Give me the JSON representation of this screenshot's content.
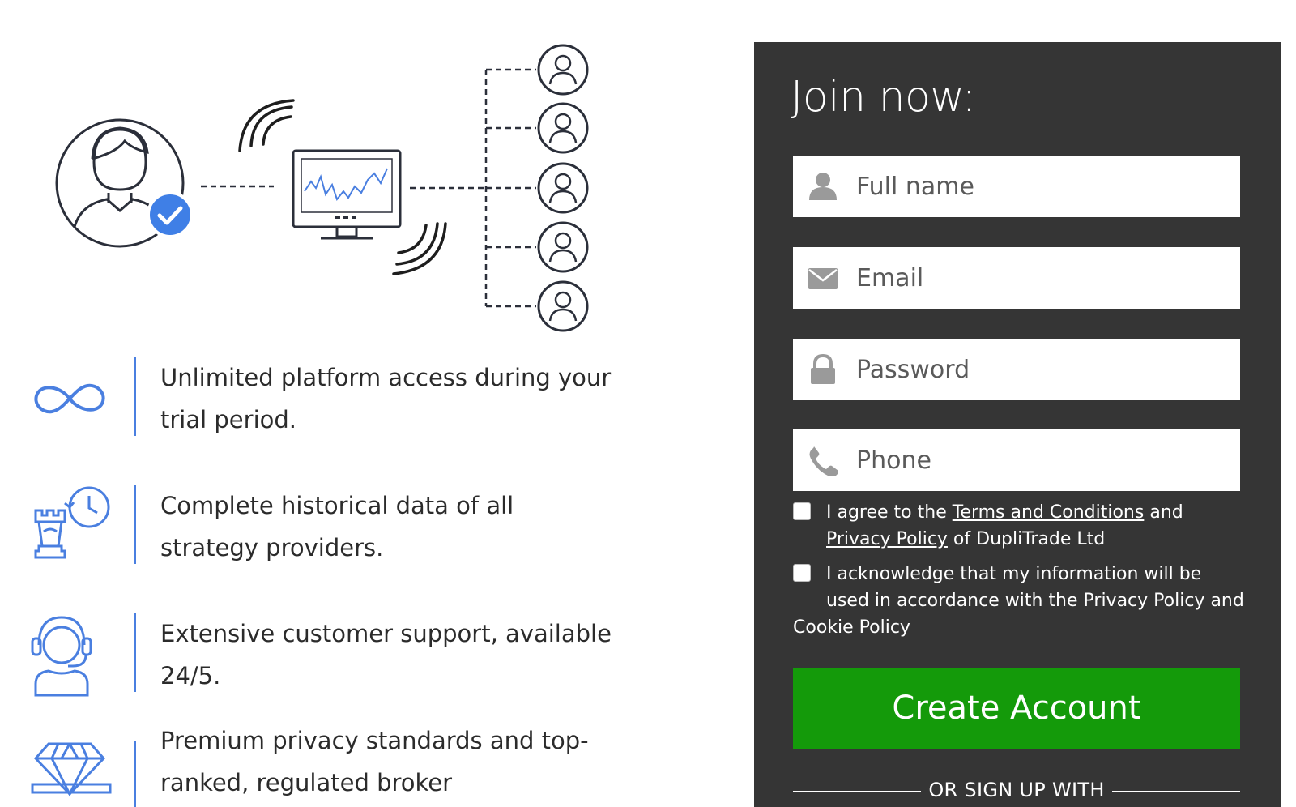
{
  "features": [
    {
      "icon": "infinity-icon",
      "text": "Unlimited platform access during your trial period."
    },
    {
      "icon": "rook-history-icon",
      "text": "Complete historical data of all strategy providers."
    },
    {
      "icon": "headset-support-icon",
      "text": "Extensive customer support, available 24/5."
    },
    {
      "icon": "diamond-icon",
      "text": "Premium privacy standards and top-ranked, regulated broker"
    }
  ],
  "signup": {
    "title": "Join now:",
    "fields": {
      "full_name": {
        "placeholder": "Full name",
        "icon": "user-icon"
      },
      "email": {
        "placeholder": "Email",
        "icon": "envelope-icon"
      },
      "password": {
        "placeholder": "Password",
        "icon": "lock-icon"
      },
      "phone": {
        "placeholder": "Phone",
        "icon": "phone-icon"
      }
    },
    "consent_terms": {
      "prefix": "I agree to the ",
      "terms_link": "Terms and Conditions",
      "middle": " and",
      "privacy_link": "Privacy Policy",
      "suffix": " of DupliTrade Ltd"
    },
    "consent_privacy": {
      "text_line1": "I acknowledge that my information will be used in accordance with the Privacy Policy and",
      "text_line2": "Cookie Policy"
    },
    "create_button": "Create Account",
    "or_sign_up_with": "OR SIGN UP WITH"
  },
  "colors": {
    "panel_bg": "#353535",
    "accent_blue": "#4a7fe0",
    "button_green": "#149a0a",
    "check_blue": "#3f7fe6"
  }
}
